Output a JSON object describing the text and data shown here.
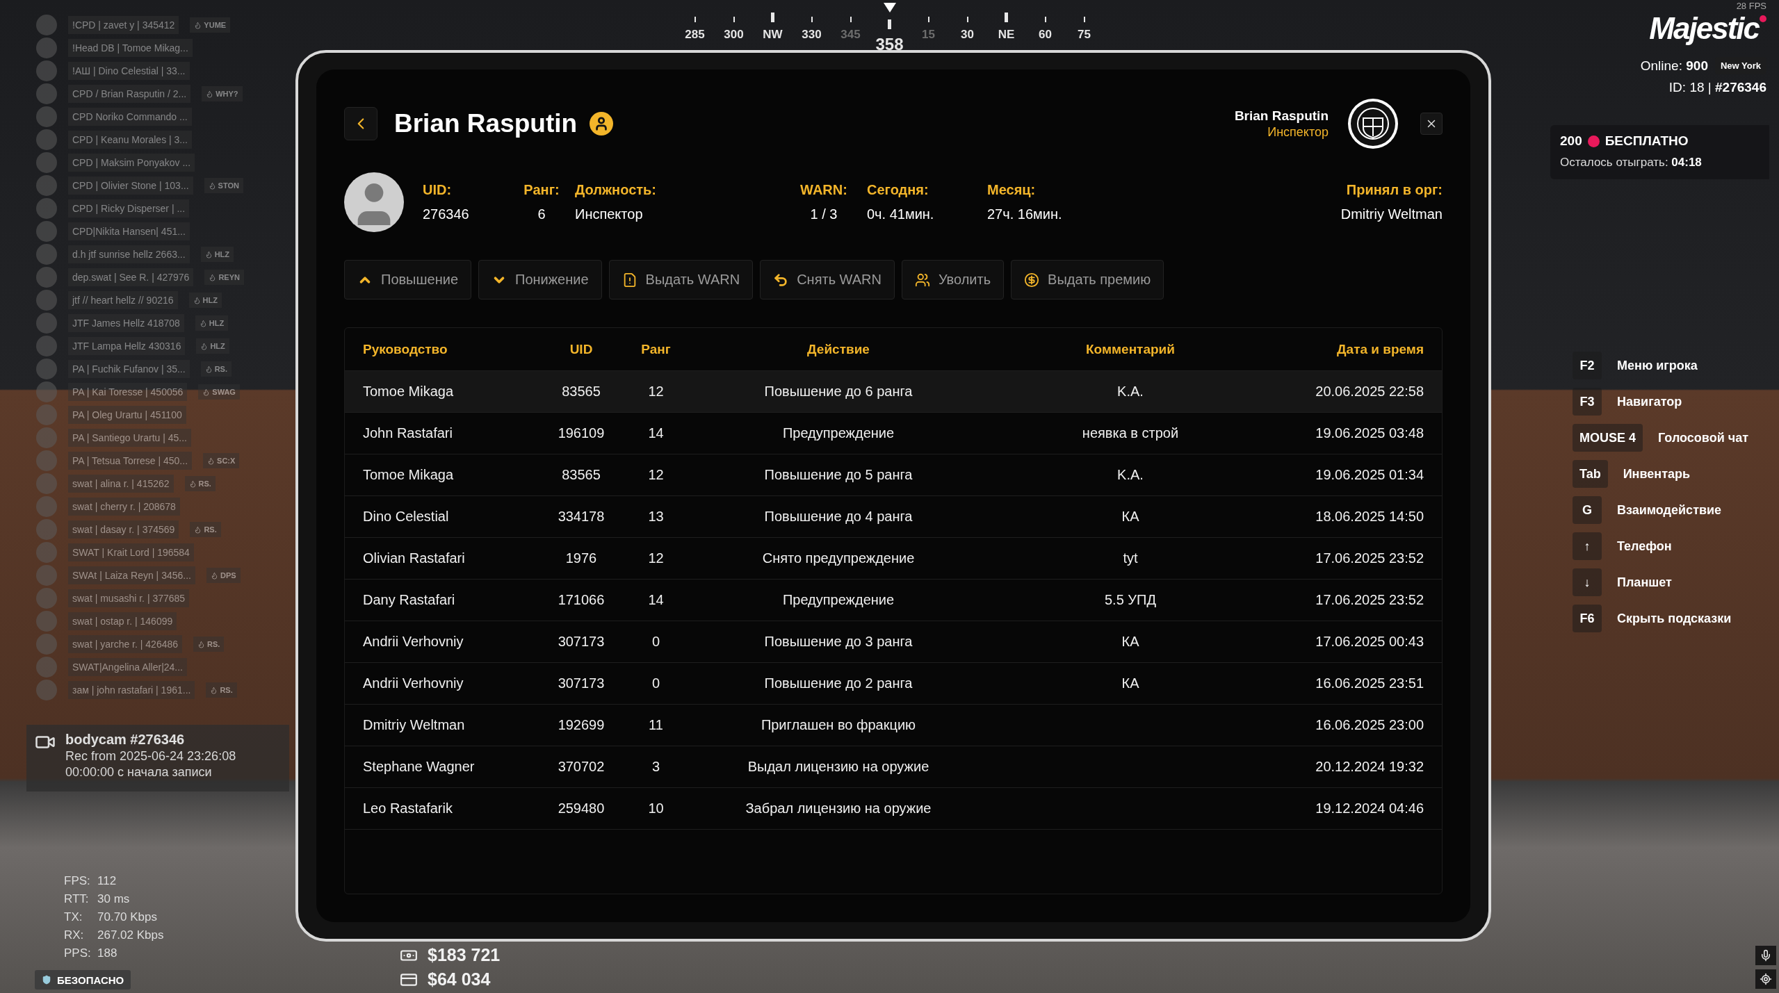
{
  "compass": {
    "items": [
      {
        "label": "285",
        "kind": "degree",
        "dim": false
      },
      {
        "label": "300",
        "kind": "degree",
        "dim": false
      },
      {
        "label": "NW",
        "kind": "cardinal",
        "dim": false
      },
      {
        "label": "330",
        "kind": "degree",
        "dim": false
      },
      {
        "label": "345",
        "kind": "degree",
        "dim": true
      },
      {
        "label": "358",
        "kind": "current",
        "dim": false
      },
      {
        "label": "15",
        "kind": "degree",
        "dim": true
      },
      {
        "label": "30",
        "kind": "degree",
        "dim": false
      },
      {
        "label": "NE",
        "kind": "cardinal",
        "dim": false
      },
      {
        "label": "60",
        "kind": "degree",
        "dim": false
      },
      {
        "label": "75",
        "kind": "degree",
        "dim": false
      }
    ]
  },
  "server": {
    "fps": "28 FPS",
    "logo": "Majestic",
    "online": "Online: **900**",
    "city": "New York",
    "id": "ID: 18 | **#276346**"
  },
  "promo": {
    "amount": "200",
    "title": "БЕСПЛАТНО",
    "remaining": "Осталось отыграть: **04:18**"
  },
  "players": [
    {
      "name": "!CPD | zavet y | 345412",
      "badge": "YUME"
    },
    {
      "name": "!Head DB | Tomoe Mikag..."
    },
    {
      "name": "!АШ | Dino Celestial | 33..."
    },
    {
      "name": "CPD / Brian Rasputin / 2...",
      "badge": "WHY?"
    },
    {
      "name": "CPD Noriko Commando ..."
    },
    {
      "name": "CPD | Keanu Morales | 3..."
    },
    {
      "name": "CPD | Maksim Ponyakov ..."
    },
    {
      "name": "CPD | Olivier Stone | 103...",
      "badge": "STON"
    },
    {
      "name": "CPD | Ricky Disperser | ..."
    },
    {
      "name": "CPD|Nikita Hansen| 451..."
    },
    {
      "name": "d.h jtf sunrise hellz 2663...",
      "badge": "HLZ"
    },
    {
      "name": "dep.swat | See R. | 427976",
      "badge": "REYN"
    },
    {
      "name": "jtf // heart hellz // 90216",
      "badge": "HLZ"
    },
    {
      "name": "JTF James Hellz 418708",
      "badge": "HLZ"
    },
    {
      "name": "JTF Lampa Hellz 430316",
      "badge": "HLZ"
    },
    {
      "name": "PA | Fuchik Fufanov | 35...",
      "badge": "RS."
    },
    {
      "name": "PA | Kai Toresse | 450056",
      "badge": "SWAG"
    },
    {
      "name": "PA | Oleg Urartu | 451100"
    },
    {
      "name": "PA | Santiego Urartu | 45..."
    },
    {
      "name": "PA | Tetsua Torrese | 450...",
      "badge": "SC:X"
    },
    {
      "name": "swat | alina r. | 415262",
      "badge": "RS."
    },
    {
      "name": "swat | cherry r. | 208678"
    },
    {
      "name": "swat | dasay r. | 374569",
      "badge": "RS."
    },
    {
      "name": "SWAT | Krait Lord | 196584"
    },
    {
      "name": "SWAt | Laiza Reyn | 3456...",
      "badge": "DPS"
    },
    {
      "name": "swat | musashi r. | 377685"
    },
    {
      "name": "swat | ostap r. | 146099"
    },
    {
      "name": "swat | yarche r. | 426486",
      "badge": "RS."
    },
    {
      "name": "SWAT|Angelina Aller|24..."
    },
    {
      "name": "зам | john rastafari | 1961...",
      "badge": "RS."
    }
  ],
  "tablet": {
    "title": "Brian Rasputin",
    "user": {
      "name": "Brian Rasputin",
      "role": "Инспектор"
    },
    "stats": [
      {
        "label": "UID:",
        "value": "276346"
      },
      {
        "label": "Ранг:",
        "value": "6"
      },
      {
        "label": "Должность:",
        "value": "Инспектор"
      },
      {
        "label": "WARN:",
        "value": "1 / 3"
      },
      {
        "label": "Сегодня:",
        "value": "0ч. 41мин."
      },
      {
        "label": "Месяц:",
        "value": "27ч. 16мин."
      },
      {
        "label": "Принял в орг:",
        "value": "Dmitriy Weltman"
      }
    ],
    "actions": [
      {
        "kind": "promote",
        "label": "Повышение"
      },
      {
        "kind": "demote",
        "label": "Понижение"
      },
      {
        "kind": "warn",
        "label": "Выдать WARN"
      },
      {
        "kind": "unwarn",
        "label": "Снять WARN"
      },
      {
        "kind": "fire",
        "label": "Уволить"
      },
      {
        "kind": "bonus",
        "label": "Выдать премию"
      }
    ],
    "table": {
      "columns": [
        "Руководство",
        "UID",
        "Ранг",
        "Действие",
        "Комментарий",
        "Дата и время"
      ],
      "rows": [
        {
          "selected": true,
          "cells": [
            "Tomoe Mikaga",
            "83565",
            "12",
            "Повышение до 6 ранга",
            "K.A.",
            "20.06.2025 22:58"
          ]
        },
        {
          "selected": false,
          "cells": [
            "John Rastafari",
            "196109",
            "14",
            "Предупреждение",
            "неявка в строй",
            "19.06.2025 03:48"
          ]
        },
        {
          "selected": false,
          "cells": [
            "Tomoe Mikaga",
            "83565",
            "12",
            "Повышение до 5 ранга",
            "K.A.",
            "19.06.2025 01:34"
          ]
        },
        {
          "selected": false,
          "cells": [
            "Dino Celestial",
            "334178",
            "13",
            "Повышение до 4 ранга",
            "КА",
            "18.06.2025 14:50"
          ]
        },
        {
          "selected": false,
          "cells": [
            "Olivian Rastafari",
            "1976",
            "12",
            "Снято предупреждение",
            "tyt",
            "17.06.2025 23:52"
          ]
        },
        {
          "selected": false,
          "cells": [
            "Dany Rastafari",
            "171066",
            "14",
            "Предупреждение",
            "5.5 УПД",
            "17.06.2025 23:52"
          ]
        },
        {
          "selected": false,
          "cells": [
            "Andrii Verhovniy",
            "307173",
            "0",
            "Повышение до 3 ранга",
            "КА",
            "17.06.2025 00:43"
          ]
        },
        {
          "selected": false,
          "cells": [
            "Andrii Verhovniy",
            "307173",
            "0",
            "Повышение до 2 ранга",
            "КА",
            "16.06.2025 23:51"
          ]
        },
        {
          "selected": false,
          "cells": [
            "Dmitriy Weltman",
            "192699",
            "11",
            "Приглашен во фракцию",
            "",
            "16.06.2025 23:00"
          ]
        },
        {
          "selected": false,
          "cells": [
            "Stephane Wagner",
            "370702",
            "3",
            "Выдал лицензию на оружие",
            "",
            "20.12.2024 19:32"
          ]
        },
        {
          "selected": false,
          "cells": [
            "Leo Rastafarik",
            "259480",
            "10",
            "Забрал лицензию на оружие",
            "",
            "19.12.2024 04:46"
          ]
        }
      ]
    }
  },
  "hints": [
    {
      "key": "F2",
      "label": "Меню игрока"
    },
    {
      "key": "F3",
      "label": "Навигатор"
    },
    {
      "key": "MOUSE 4",
      "label": "Голосовой чат"
    },
    {
      "key": "Tab",
      "label": "Инвентарь"
    },
    {
      "key": "G",
      "label": "Взаимодействие"
    },
    {
      "key": "↑",
      "label": "Телефон"
    },
    {
      "key": "↓",
      "label": "Планшет"
    },
    {
      "key": "F6",
      "label": "Скрыть подсказки"
    }
  ],
  "bodycam": {
    "title": "bodycam #276346",
    "recording": "Rec from 2025-06-24 23:26:08",
    "elapsed": "00:00:00 с начала записи"
  },
  "net_stats": [
    {
      "label": "FPS:",
      "value": "112"
    },
    {
      "label": "RTT:",
      "value": "30 ms"
    },
    {
      "label": "TX:",
      "value": "70.70 Kbps"
    },
    {
      "label": "RX:",
      "value": "267.02 Kbps"
    },
    {
      "label": "PPS:",
      "value": "188"
    }
  ],
  "zone_badge": "БЕЗОПАСНО",
  "money": [
    {
      "kind": "cash",
      "amount": "$183 721"
    },
    {
      "kind": "bank",
      "amount": "$64 034"
    }
  ]
}
